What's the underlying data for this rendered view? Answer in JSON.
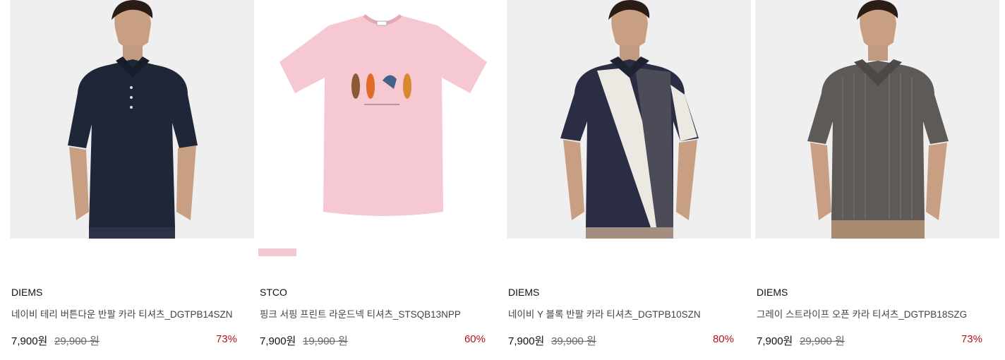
{
  "colors": {
    "discount": "#b0141c",
    "swatch": "#f2c9d1"
  },
  "products": [
    {
      "brand": "DIEMS",
      "name": "네이비 테리 버튼다운 반팔 카라 티셔츠_DGTPB14SZN",
      "price": "7,900원",
      "original_price": "29,900 원",
      "discount": "73%"
    },
    {
      "brand": "STCO",
      "name": "핑크 서핑 프린트 라운드넥 티셔츠_STSQB13NPP",
      "price": "7,900원",
      "original_price": "19,900 원",
      "discount": "60%",
      "color_swatch": "pink"
    },
    {
      "brand": "DIEMS",
      "name": "네이비 Y 블록 반팔 카라 티셔츠_DGTPB10SZN",
      "price": "7,900원",
      "original_price": "39,900 원",
      "discount": "80%"
    },
    {
      "brand": "DIEMS",
      "name": "그레이 스트라이프 오픈 카라 티셔츠_DGTPB18SZG",
      "price": "7,900원",
      "original_price": "29,900 원",
      "discount": "73%"
    }
  ]
}
